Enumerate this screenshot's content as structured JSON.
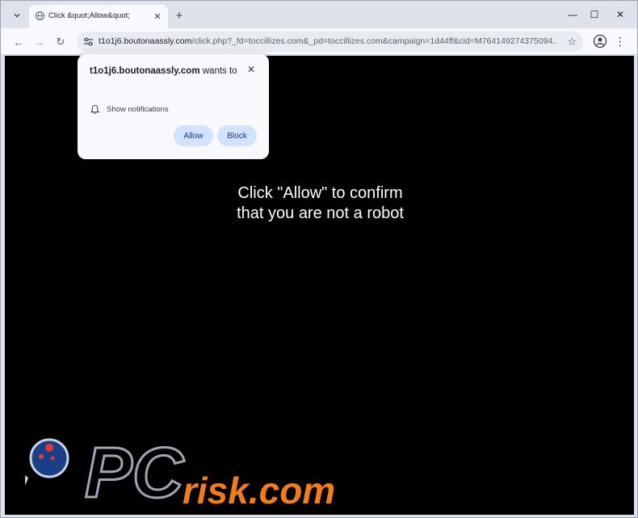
{
  "tab": {
    "title": "Click &quot;Allow&quot;",
    "close_glyph": "✕",
    "new_tab_glyph": "+"
  },
  "window_controls": {
    "minimize": "—",
    "maximize": "☐",
    "close": "✕"
  },
  "toolbar": {
    "back": "←",
    "forward": "→",
    "reload": "↻",
    "url_domain": "t1o1j6.boutonaassly.com",
    "url_rest": "/click.php?_fd=toccillizes.com&_pd=toccillizes.com&campaign=1d44ff&cid=M764149274375094...",
    "star": "☆",
    "menu": "⋮"
  },
  "popup": {
    "site": "t1o1j6.boutonaassly.com",
    "wants": " wants to",
    "permission": "Show notifications",
    "allow_label": "Allow",
    "block_label": "Block",
    "close_glyph": "✕"
  },
  "page": {
    "line1": "Click \"Allow\" to confirm",
    "line2": "that you are not a robot"
  },
  "watermark": {
    "text": "PCrisk.com"
  },
  "colors": {
    "accent": "#d3e3fd",
    "page_bg": "#000000",
    "watermark_orange": "#f07d1a"
  }
}
